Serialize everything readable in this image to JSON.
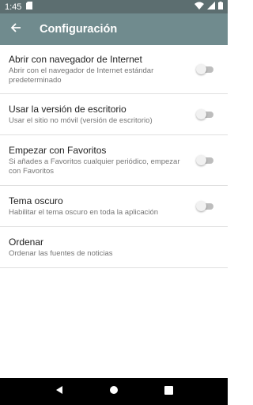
{
  "status_bar": {
    "time": "1:45"
  },
  "app_bar": {
    "title": "Configuración"
  },
  "settings": [
    {
      "title": "Abrir con navegador de Internet",
      "summary": "Abrir con el navegador de Internet estándar predeterminado",
      "toggle": false
    },
    {
      "title": "Usar la versión de escritorio",
      "summary": "Usar el sitio no móvil (versión de escritorio)",
      "toggle": false
    },
    {
      "title": "Empezar con Favoritos",
      "summary": "Si añades a Favoritos cualquier periódico, empezar con Favoritos",
      "toggle": false
    },
    {
      "title": "Tema oscuro",
      "summary": "Habilitar el tema oscuro en toda la aplicación",
      "toggle": false
    },
    {
      "title": "Ordenar",
      "summary": "Ordenar las fuentes de noticias"
    }
  ],
  "colors": {
    "app_bar": "#708b8e",
    "status_bar": "#5c6e70",
    "toggle_off_track": "#bdbdbd"
  }
}
